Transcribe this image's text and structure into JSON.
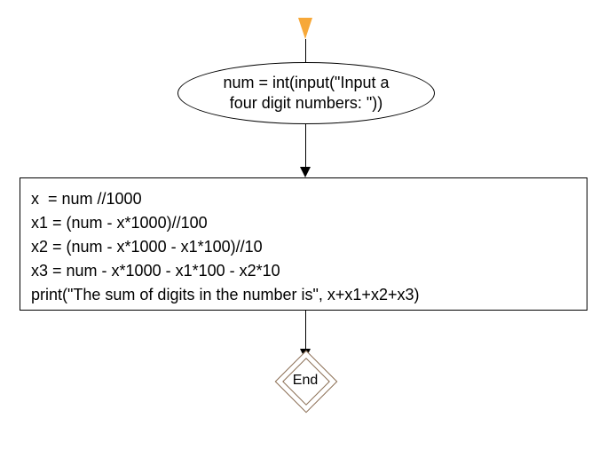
{
  "flowchart": {
    "input_node": {
      "line1": "num = int(input(\"Input a",
      "line2": "four digit numbers: \"))"
    },
    "process_node": {
      "line1": "x  = num //1000",
      "line2": "x1 = (num - x*1000)//100",
      "line3": "x2 = (num - x*1000 - x1*100)//10",
      "line4": "x3 = num - x*1000 - x1*100 - x2*10",
      "line5": "print(\"The sum of digits in the number is\", x+x1+x2+x3)"
    },
    "end_node": {
      "label": "End"
    }
  }
}
